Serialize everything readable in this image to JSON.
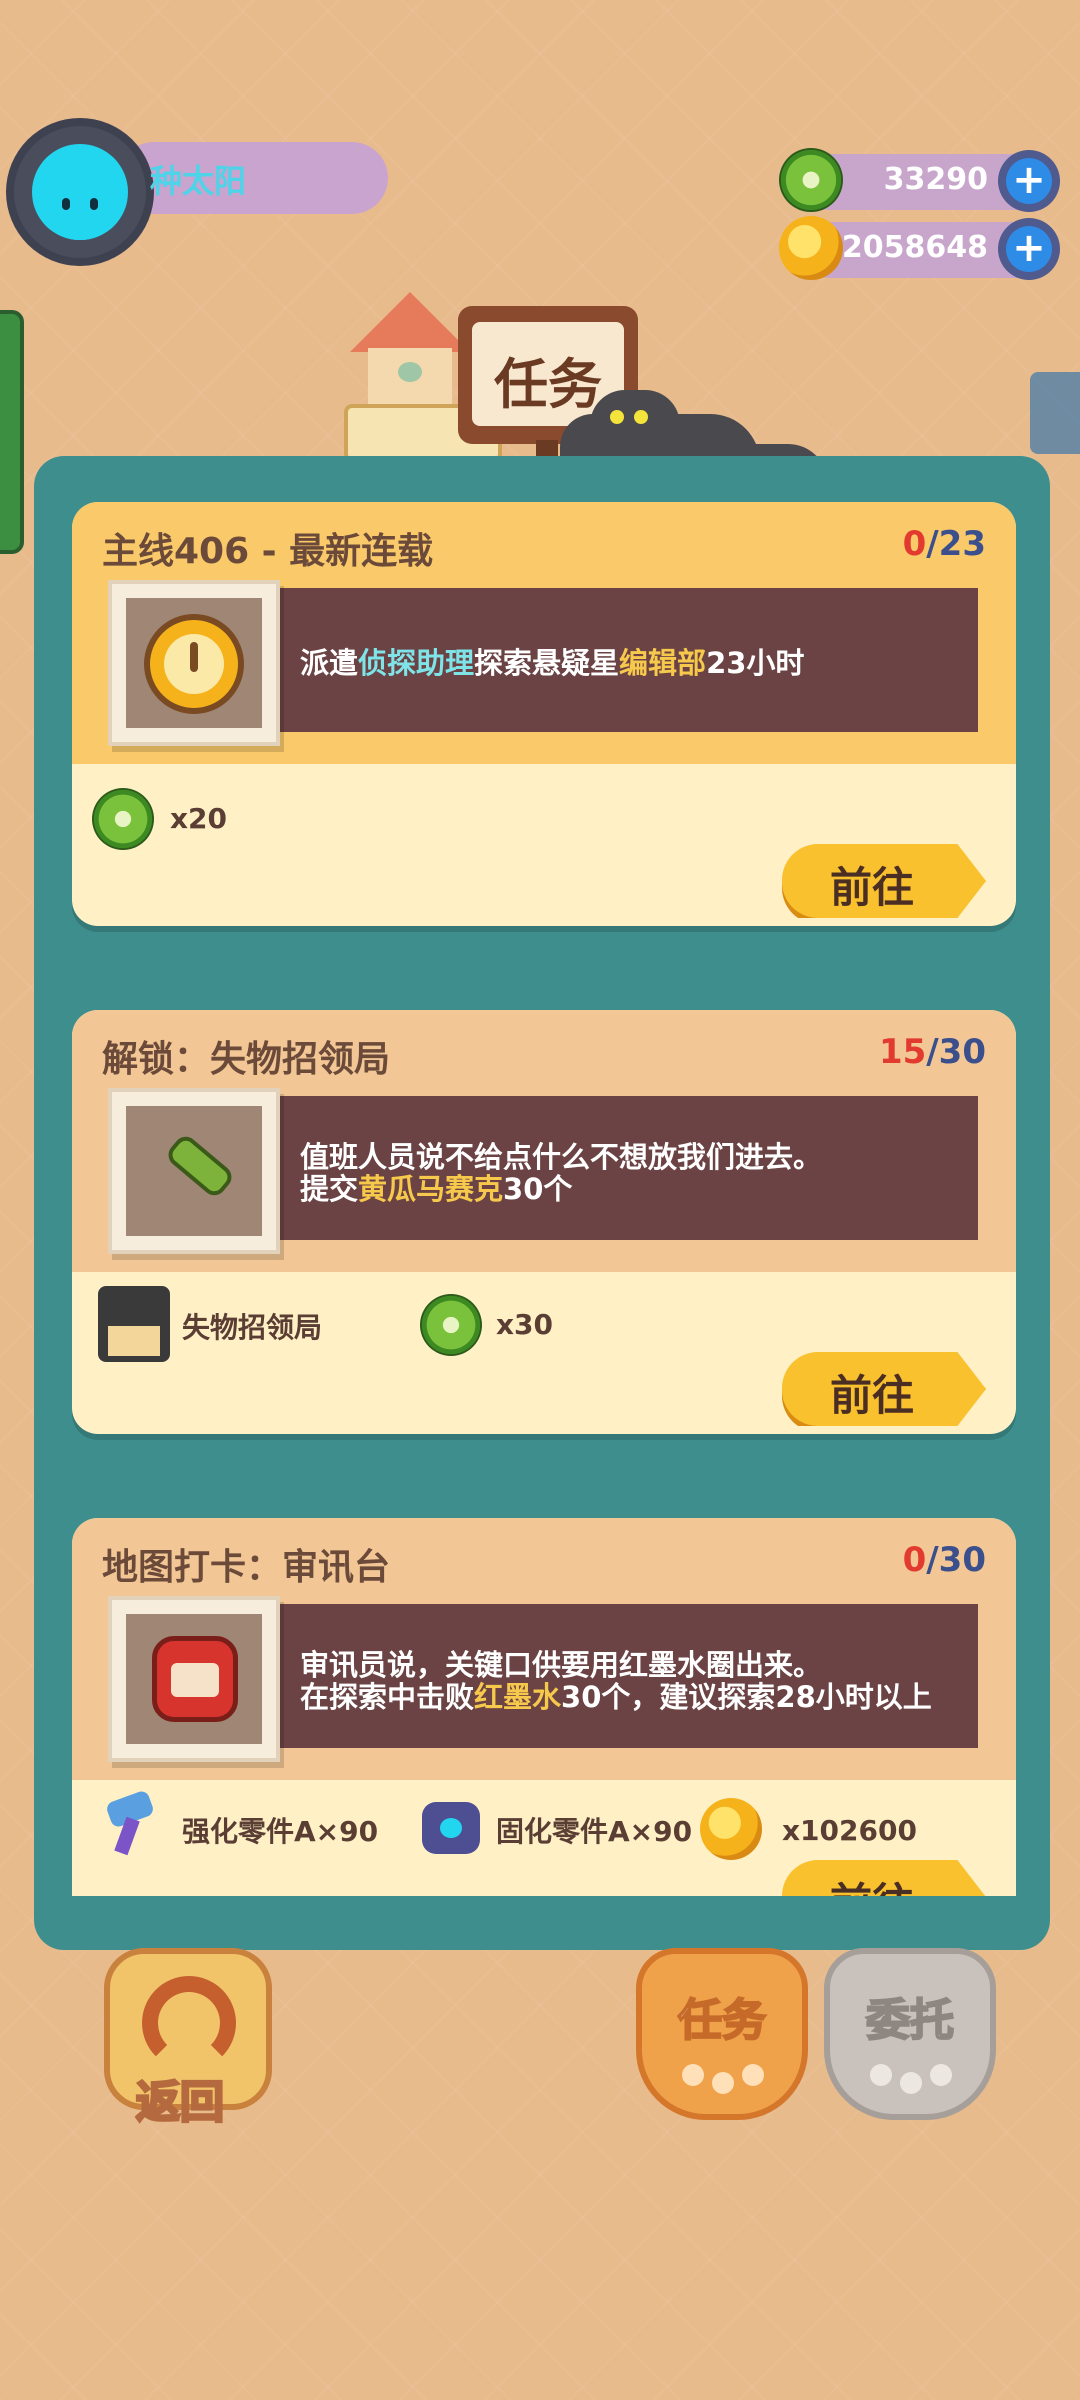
{
  "player": {
    "name": "种太阳"
  },
  "resources": [
    {
      "icon": "green-donut-icon",
      "value": "33290"
    },
    {
      "icon": "gold-coin-icon",
      "value": "2058648"
    }
  ],
  "header": {
    "title": "任务"
  },
  "tasks": [
    {
      "title": "主线406 - 最新连载",
      "progress_current": "0",
      "progress_total": "/23",
      "icon": "stopwatch-icon",
      "desc_line1": [
        "派遣",
        "侦探助理",
        "探索悬疑星",
        "编辑部",
        "23小时"
      ],
      "rewards": [
        {
          "icon": "green-donut-icon",
          "label": "x20"
        }
      ],
      "button": "前往"
    },
    {
      "title": "解锁：失物招领局",
      "progress_current": "15",
      "progress_total": "/30",
      "icon": "cucumber-icon",
      "desc_line1": "值班人员说不给点什么不想放我们进去。",
      "desc_line2": [
        "提交",
        "黄瓜马赛克",
        "30个"
      ],
      "rewards": [
        {
          "icon": "building-icon",
          "label": "失物招领局"
        },
        {
          "icon": "green-donut-icon",
          "label": "x30"
        }
      ],
      "button": "前往"
    },
    {
      "title": "地图打卡：审讯台",
      "progress_current": "0",
      "progress_total": "/30",
      "icon": "red-ink-icon",
      "desc_line1": "审讯员说，关键口供要用红墨水圈出来。",
      "desc_line2": [
        "在探索中击败",
        "红墨水",
        "30个，建议探索28小时以上"
      ],
      "rewards": [
        {
          "icon": "bolt-part-icon",
          "label": "强化零件A×90"
        },
        {
          "icon": "nut-part-icon",
          "label": "固化零件A×90"
        },
        {
          "icon": "gold-coin-icon",
          "label": "x102600"
        }
      ],
      "button": "前往"
    }
  ],
  "bottom": {
    "back": "返回",
    "tab_tasks": "任务",
    "tab_commission": "委托"
  },
  "colors": {
    "panel": "#3F8E8E",
    "card_header": "#F9C96A",
    "go_button": "#F9C12E"
  }
}
